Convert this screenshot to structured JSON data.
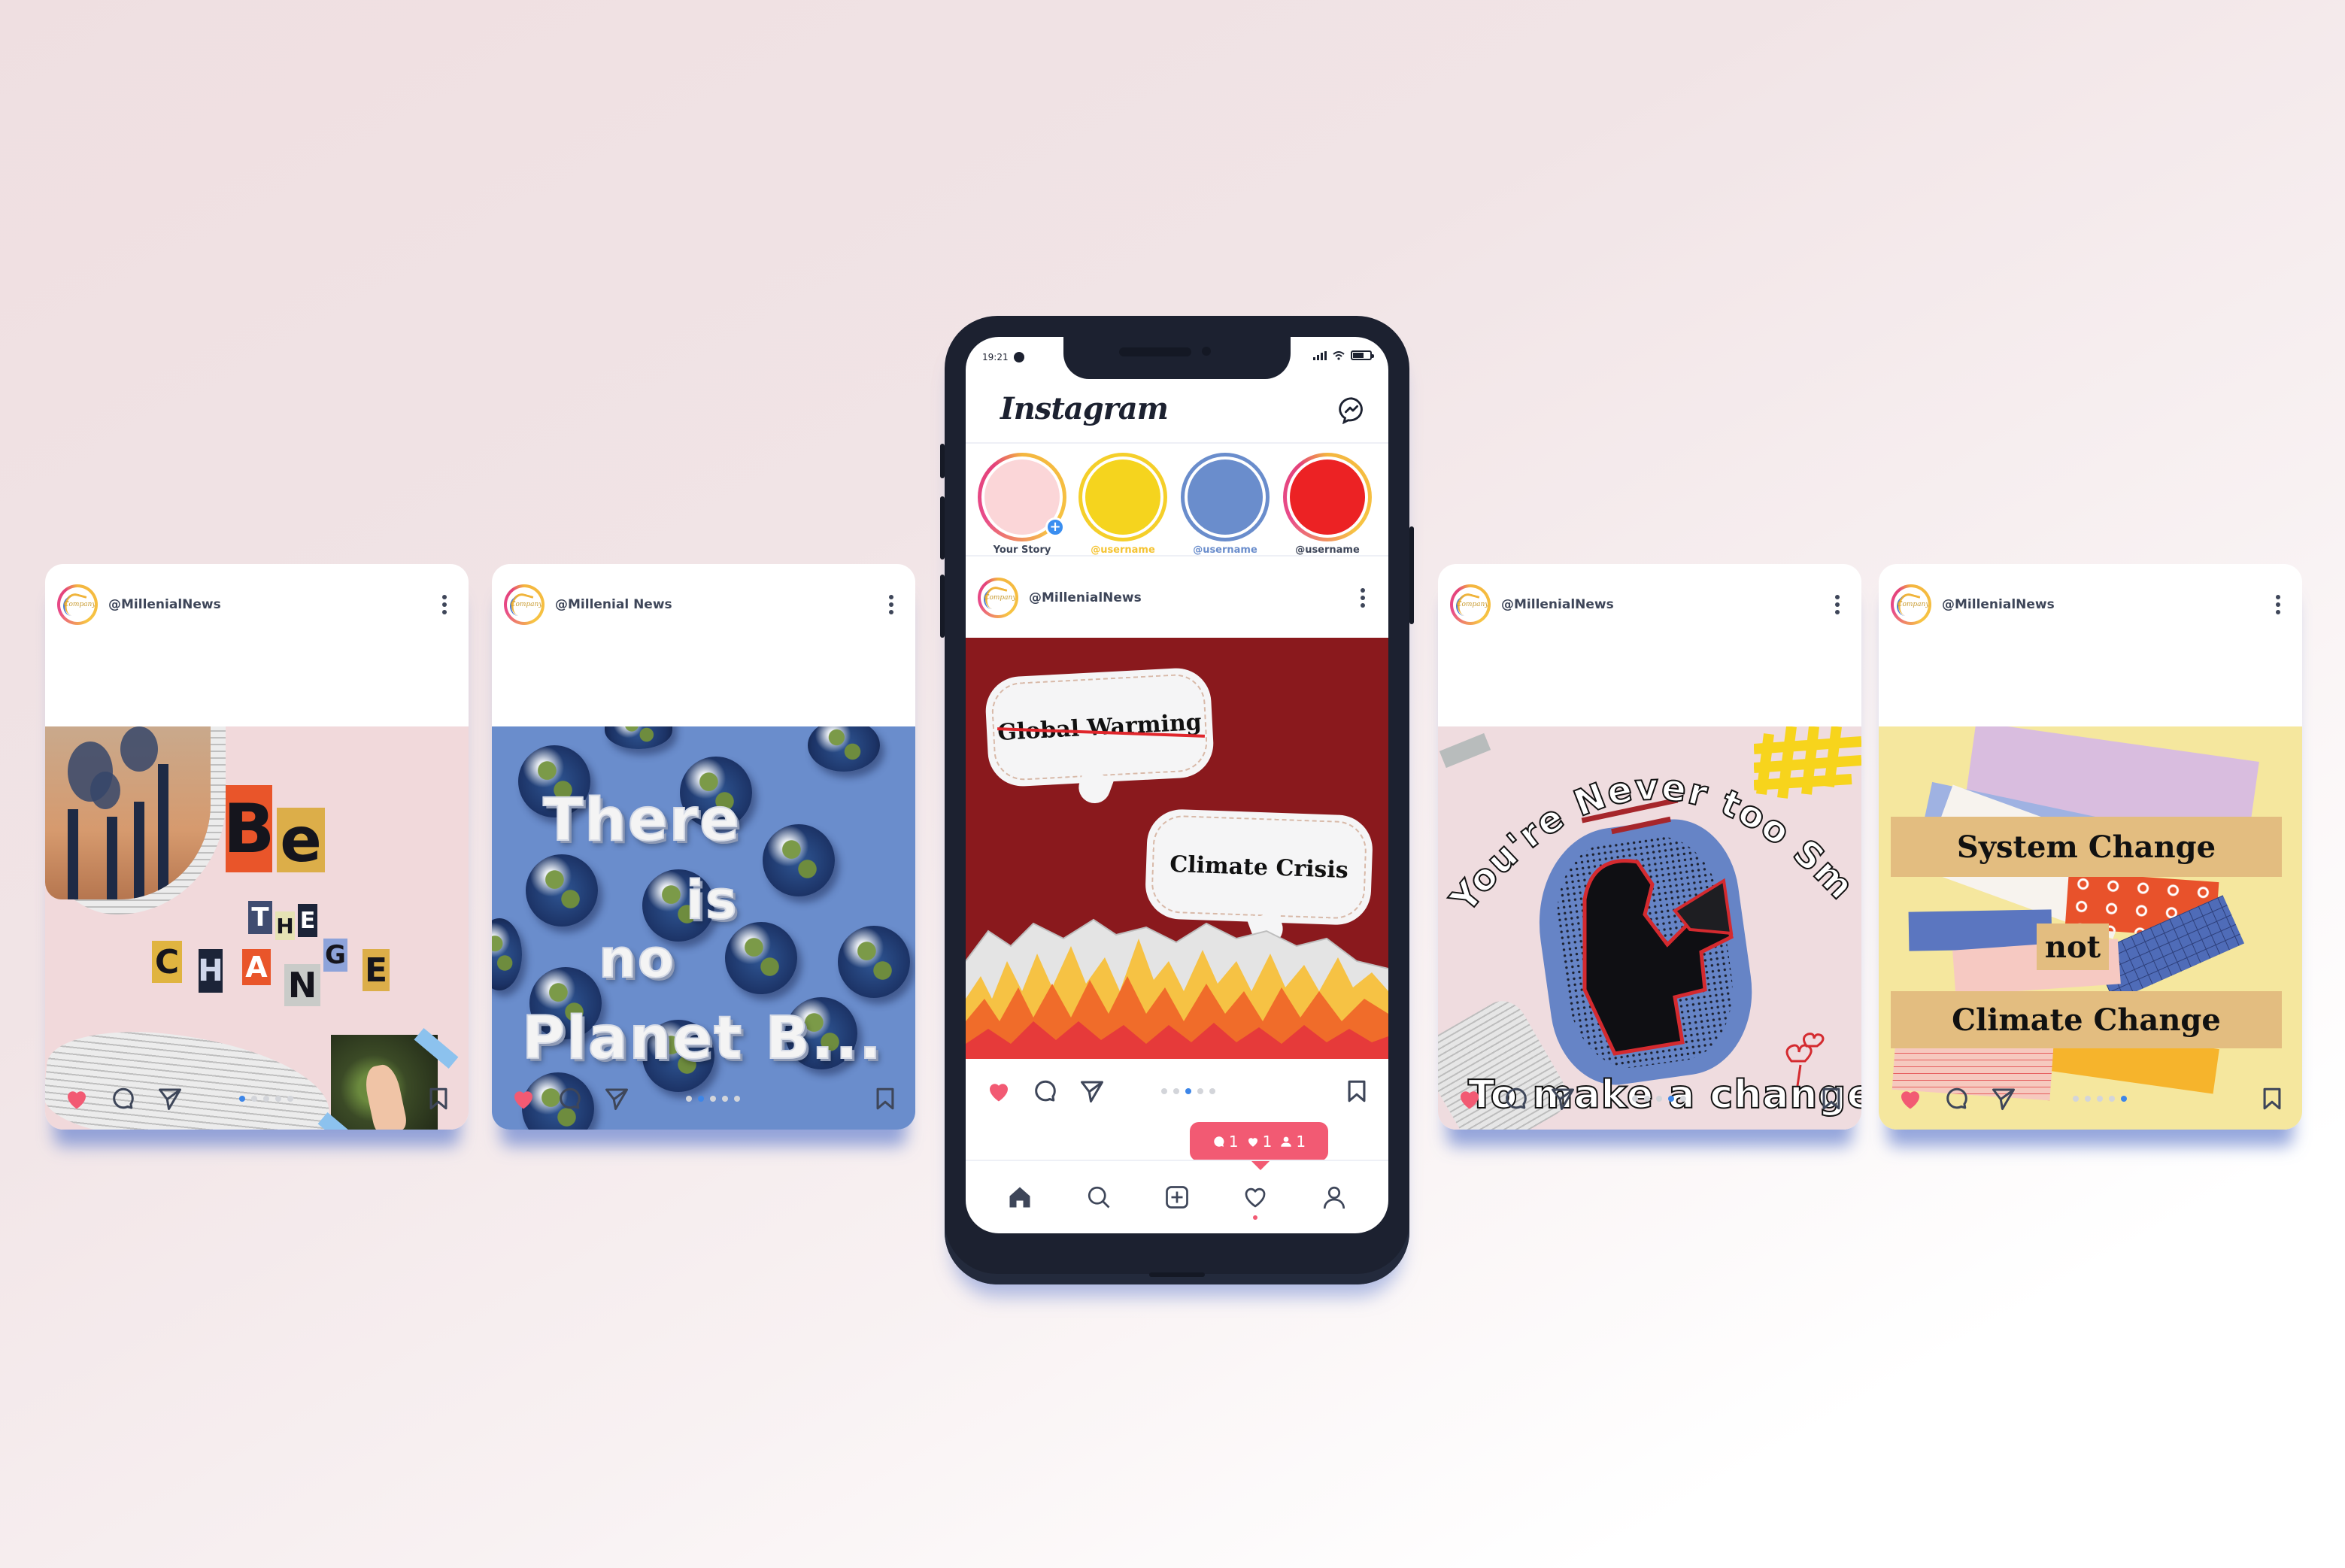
{
  "colors": {
    "accent_blue": "#3d86e8",
    "like_red": "#f25a73",
    "icon_dark": "#3e4659",
    "phone_frame": "#1c2130"
  },
  "phone": {
    "status_bar": {
      "time": "19:21",
      "icons": [
        "messenger-icon",
        "signal-icon",
        "wifi-icon",
        "battery-icon"
      ]
    },
    "app_title": "Instagram",
    "header_icon": "messenger-icon",
    "stories": [
      {
        "label": "Your Story",
        "color": "#fbd6d8",
        "ring": "gradient",
        "label_color": "#3e4659",
        "has_add": true
      },
      {
        "label": "@username",
        "color": "#f5d41e",
        "ring": "#f5cf2a",
        "label_color": "#f5c331"
      },
      {
        "label": "@username",
        "color": "#6a8dcc",
        "ring": "#6a8dcc",
        "label_color": "#6a8dcc"
      },
      {
        "label": "@username",
        "color": "#ec2224",
        "ring": "gradient",
        "label_color": "#3e4659"
      }
    ],
    "post": {
      "handle": "@MillenialNews",
      "avatar_text": "Company",
      "bubble_1": "Global Warming",
      "bubble_1_struck": true,
      "bubble_2": "Climate Crisis",
      "carousel": {
        "count": 5,
        "active": 3
      }
    },
    "notifications": {
      "comments": "1",
      "likes": "1",
      "followers": "1"
    },
    "bottom_nav": [
      {
        "name": "home",
        "icon": "home-icon",
        "active": true
      },
      {
        "name": "search",
        "icon": "search-icon"
      },
      {
        "name": "new-post",
        "icon": "plus-square-icon"
      },
      {
        "name": "activity",
        "icon": "heart-outline-icon",
        "has_dot": true
      },
      {
        "name": "profile",
        "icon": "user-icon"
      }
    ]
  },
  "cards": [
    {
      "handle": "@MillenialNews",
      "avatar_text": "Company",
      "image_text": [
        "Be",
        "THE",
        "CHANGE"
      ],
      "carousel": {
        "count": 5,
        "active": 1
      }
    },
    {
      "handle": "@Millenial News",
      "avatar_text": "Company",
      "image_text": [
        "There",
        "is",
        "no",
        "Planet B..."
      ],
      "carousel": {
        "count": 5,
        "active": 2
      }
    },
    {
      "handle": "@MillenialNews",
      "avatar_text": "Company",
      "image_text": [
        "You're Never too Small",
        "To make a change"
      ],
      "carousel": {
        "count": 5,
        "active": 4
      }
    },
    {
      "handle": "@MillenialNews",
      "avatar_text": "Company",
      "image_text": [
        "System Change",
        "not",
        "Climate Change"
      ],
      "carousel": {
        "count": 5,
        "active": 5
      }
    }
  ]
}
